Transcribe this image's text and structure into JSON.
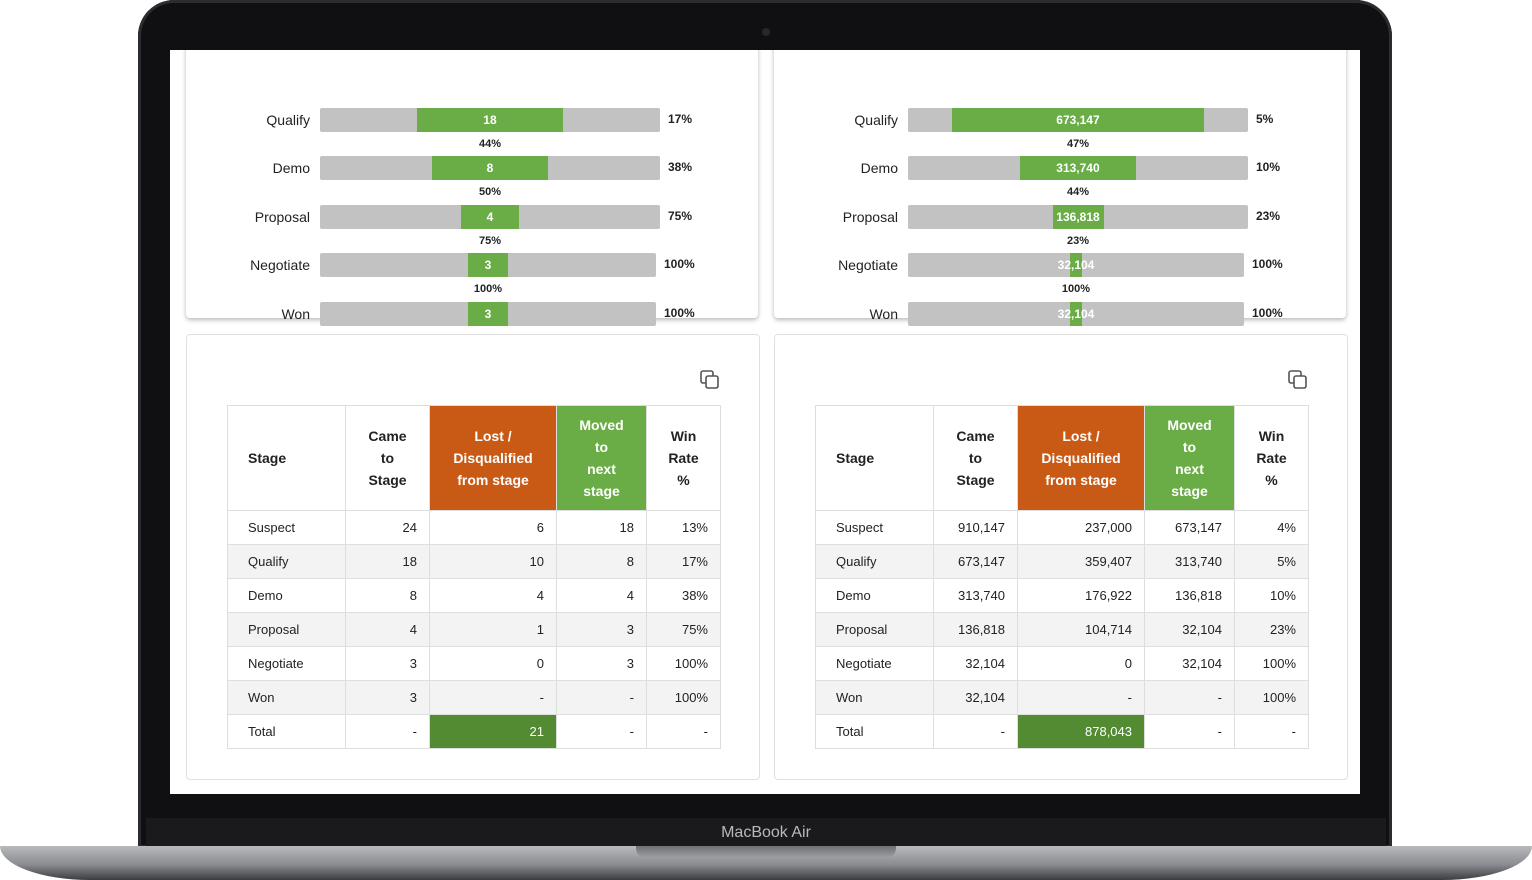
{
  "device": {
    "label": "MacBook Air"
  },
  "left_panel": {
    "funnel": [
      {
        "stage": "Qualify",
        "value": "18",
        "share": 0.43,
        "win_rate": "17%"
      },
      {
        "stage": "Demo",
        "value": "8",
        "share": 0.34,
        "win_rate": "38%"
      },
      {
        "stage": "Proposal",
        "value": "4",
        "share": 0.17,
        "win_rate": "75%"
      },
      {
        "stage": "Negotiate",
        "value": "3",
        "share": 0.12,
        "win_rate": "100%"
      },
      {
        "stage": "Won",
        "value": "3",
        "share": 0.12,
        "win_rate": "100%"
      }
    ],
    "conversions": [
      "44%",
      "50%",
      "75%",
      "100%"
    ],
    "table": {
      "headers": {
        "stage": "Stage",
        "came": [
          "Came",
          "to",
          "Stage"
        ],
        "lost": [
          "Lost /",
          "Disqualified",
          "from stage"
        ],
        "moved": [
          "Moved",
          "to",
          "next",
          "stage"
        ],
        "win": [
          "Win",
          "Rate",
          "%"
        ]
      },
      "rows": [
        [
          "Suspect",
          "24",
          "6",
          "18",
          "13%"
        ],
        [
          "Qualify",
          "18",
          "10",
          "8",
          "17%"
        ],
        [
          "Demo",
          "8",
          "4",
          "4",
          "38%"
        ],
        [
          "Proposal",
          "4",
          "1",
          "3",
          "75%"
        ],
        [
          "Negotiate",
          "3",
          "0",
          "3",
          "100%"
        ],
        [
          "Won",
          "3",
          "-",
          "-",
          "100%"
        ],
        [
          "Total",
          "-",
          "21",
          "-",
          "-"
        ]
      ]
    }
  },
  "right_panel": {
    "funnel": [
      {
        "stage": "Qualify",
        "value": "673,147",
        "share": 0.74,
        "win_rate": "5%"
      },
      {
        "stage": "Demo",
        "value": "313,740",
        "share": 0.34,
        "win_rate": "10%"
      },
      {
        "stage": "Proposal",
        "value": "136,818",
        "share": 0.15,
        "win_rate": "23%"
      },
      {
        "stage": "Negotiate",
        "value": "32,104",
        "share": 0.035,
        "win_rate": "100%"
      },
      {
        "stage": "Won",
        "value": "32,104",
        "share": 0.035,
        "win_rate": "100%"
      }
    ],
    "conversions": [
      "47%",
      "44%",
      "23%",
      "100%"
    ],
    "table": {
      "headers": {
        "stage": "Stage",
        "came": [
          "Came",
          "to",
          "Stage"
        ],
        "lost": [
          "Lost /",
          "Disqualified",
          "from stage"
        ],
        "moved": [
          "Moved",
          "to",
          "next",
          "stage"
        ],
        "win": [
          "Win",
          "Rate",
          "%"
        ]
      },
      "rows": [
        [
          "Suspect",
          "910,147",
          "237,000",
          "673,147",
          "4%"
        ],
        [
          "Qualify",
          "673,147",
          "359,407",
          "313,740",
          "5%"
        ],
        [
          "Demo",
          "313,740",
          "176,922",
          "136,818",
          "10%"
        ],
        [
          "Proposal",
          "136,818",
          "104,714",
          "32,104",
          "23%"
        ],
        [
          "Negotiate",
          "32,104",
          "0",
          "32,104",
          "100%"
        ],
        [
          "Won",
          "32,104",
          "-",
          "-",
          "100%"
        ],
        [
          "Total",
          "-",
          "878,043",
          "-",
          "-"
        ]
      ]
    }
  },
  "colors": {
    "bar_fill": "#6aad46",
    "bar_track": "#c2c2c2",
    "lost_header": "#c95a16",
    "moved_header": "#6aad46",
    "total_lost": "#538b33"
  },
  "icons": {
    "copy": "copy-icon"
  }
}
